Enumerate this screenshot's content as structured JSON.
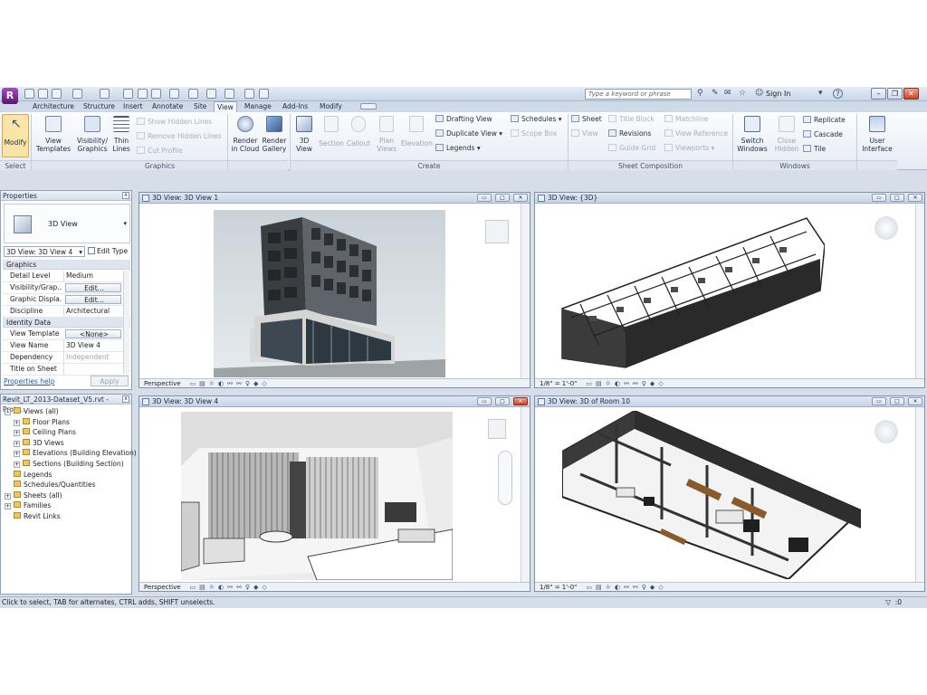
{
  "app": {
    "logo_letter": "R"
  },
  "search": {
    "placeholder": "Type a keyword or phrase"
  },
  "titlebar": {
    "signin": "Sign In",
    "help": "?"
  },
  "tabs": [
    "Architecture",
    "Structure",
    "Insert",
    "Annotate",
    "Site",
    "View",
    "Manage",
    "Add-Ins",
    "Modify"
  ],
  "active_tab": "View",
  "ribbon": {
    "modify": "Modify",
    "select_panel": "Select",
    "view_templates": [
      "View",
      "Templates"
    ],
    "visibility_graphics": [
      "Visibility/",
      "Graphics"
    ],
    "thin_lines": [
      "Thin",
      "Lines"
    ],
    "show_hidden_lines": "Show  Hidden Lines",
    "remove_hidden_lines": "Remove  Hidden  Lines",
    "cut_profile": "Cut  Profile",
    "graphics_panel": "Graphics",
    "render_cloud": [
      "Render",
      "in Cloud"
    ],
    "render_gallery": [
      "Render",
      "Gallery"
    ],
    "view_3d": [
      "3D",
      "View"
    ],
    "section": "Section",
    "callout": "Callout",
    "plan_views": [
      "Plan",
      "Views"
    ],
    "elevation": "Elevation",
    "drafting_view": "Drafting  View",
    "duplicate_view": "Duplicate  View",
    "legends": "Legends",
    "schedules": "Schedules",
    "scope_box": "Scope  Box",
    "create_panel": "Create",
    "sheet": "Sheet",
    "view": "View",
    "title_block": "Title  Block",
    "revisions": "Revisions",
    "guide_grid": "Guide  Grid",
    "matchline": "Matchline",
    "view_reference": "View  Reference",
    "viewports": "Viewports",
    "sheet_panel": "Sheet Composition",
    "switch_windows": [
      "Switch",
      "Windows"
    ],
    "close_hidden": [
      "Close",
      "Hidden"
    ],
    "replicate": "Replicate",
    "cascade": "Cascade",
    "tile": "Tile",
    "user_interface": [
      "User",
      "Interface"
    ],
    "windows_panel": "Windows"
  },
  "properties": {
    "title": "Properties",
    "type_name": "3D View",
    "selector": "3D View: 3D View 4",
    "edit_type": "Edit Type",
    "groups": [
      {
        "name": "Graphics",
        "rows": [
          {
            "key": "Detail Level",
            "value": "Medium",
            "button": false
          },
          {
            "key": "Visibility/Grap...",
            "value": "Edit...",
            "button": true
          },
          {
            "key": "Graphic Displa...",
            "value": "Edit...",
            "button": true
          },
          {
            "key": "Discipline",
            "value": "Architectural",
            "button": false
          }
        ]
      },
      {
        "name": "Identity Data",
        "rows": [
          {
            "key": "View Template",
            "value": "<None>",
            "button": true
          },
          {
            "key": "View Name",
            "value": "3D View 4",
            "button": false
          },
          {
            "key": "Dependency",
            "value": "Independent",
            "button": false
          },
          {
            "key": "Title on Sheet",
            "value": "",
            "button": false
          }
        ]
      }
    ],
    "help_link": "Properties help",
    "apply": "Apply"
  },
  "browser": {
    "title": "Revit_LT_2013-Dataset_V5.rvt - Proje...",
    "items": [
      {
        "label": "Views (all)",
        "level": 0,
        "expander": "−"
      },
      {
        "label": "Floor Plans",
        "level": 1,
        "expander": "+"
      },
      {
        "label": "Ceiling Plans",
        "level": 1,
        "expander": "+"
      },
      {
        "label": "3D Views",
        "level": 1,
        "expander": "+"
      },
      {
        "label": "Elevations (Building Elevation)",
        "level": 1,
        "expander": "+"
      },
      {
        "label": "Sections (Building Section)",
        "level": 1,
        "expander": "+"
      },
      {
        "label": "Legends",
        "level": 0,
        "expander": ""
      },
      {
        "label": "Schedules/Quantities",
        "level": 0,
        "expander": ""
      },
      {
        "label": "Sheets (all)",
        "level": 0,
        "expander": "+"
      },
      {
        "label": "Families",
        "level": 0,
        "expander": "+"
      },
      {
        "label": "Revit Links",
        "level": 0,
        "expander": ""
      }
    ]
  },
  "views": [
    {
      "title": "3D View: 3D View 1",
      "footer": "Perspective"
    },
    {
      "title": "3D View: {3D}",
      "footer": "1/8\" = 1'-0\""
    },
    {
      "title": "3D View: 3D View 4",
      "footer": "Perspective"
    },
    {
      "title": "3D View: 3D of Room 10",
      "footer": "1/8\" = 1'-0\""
    }
  ],
  "status": {
    "text": "Click to select, TAB for alternates, CTRL adds, SHIFT unselects.",
    "filter_count": ":0"
  }
}
